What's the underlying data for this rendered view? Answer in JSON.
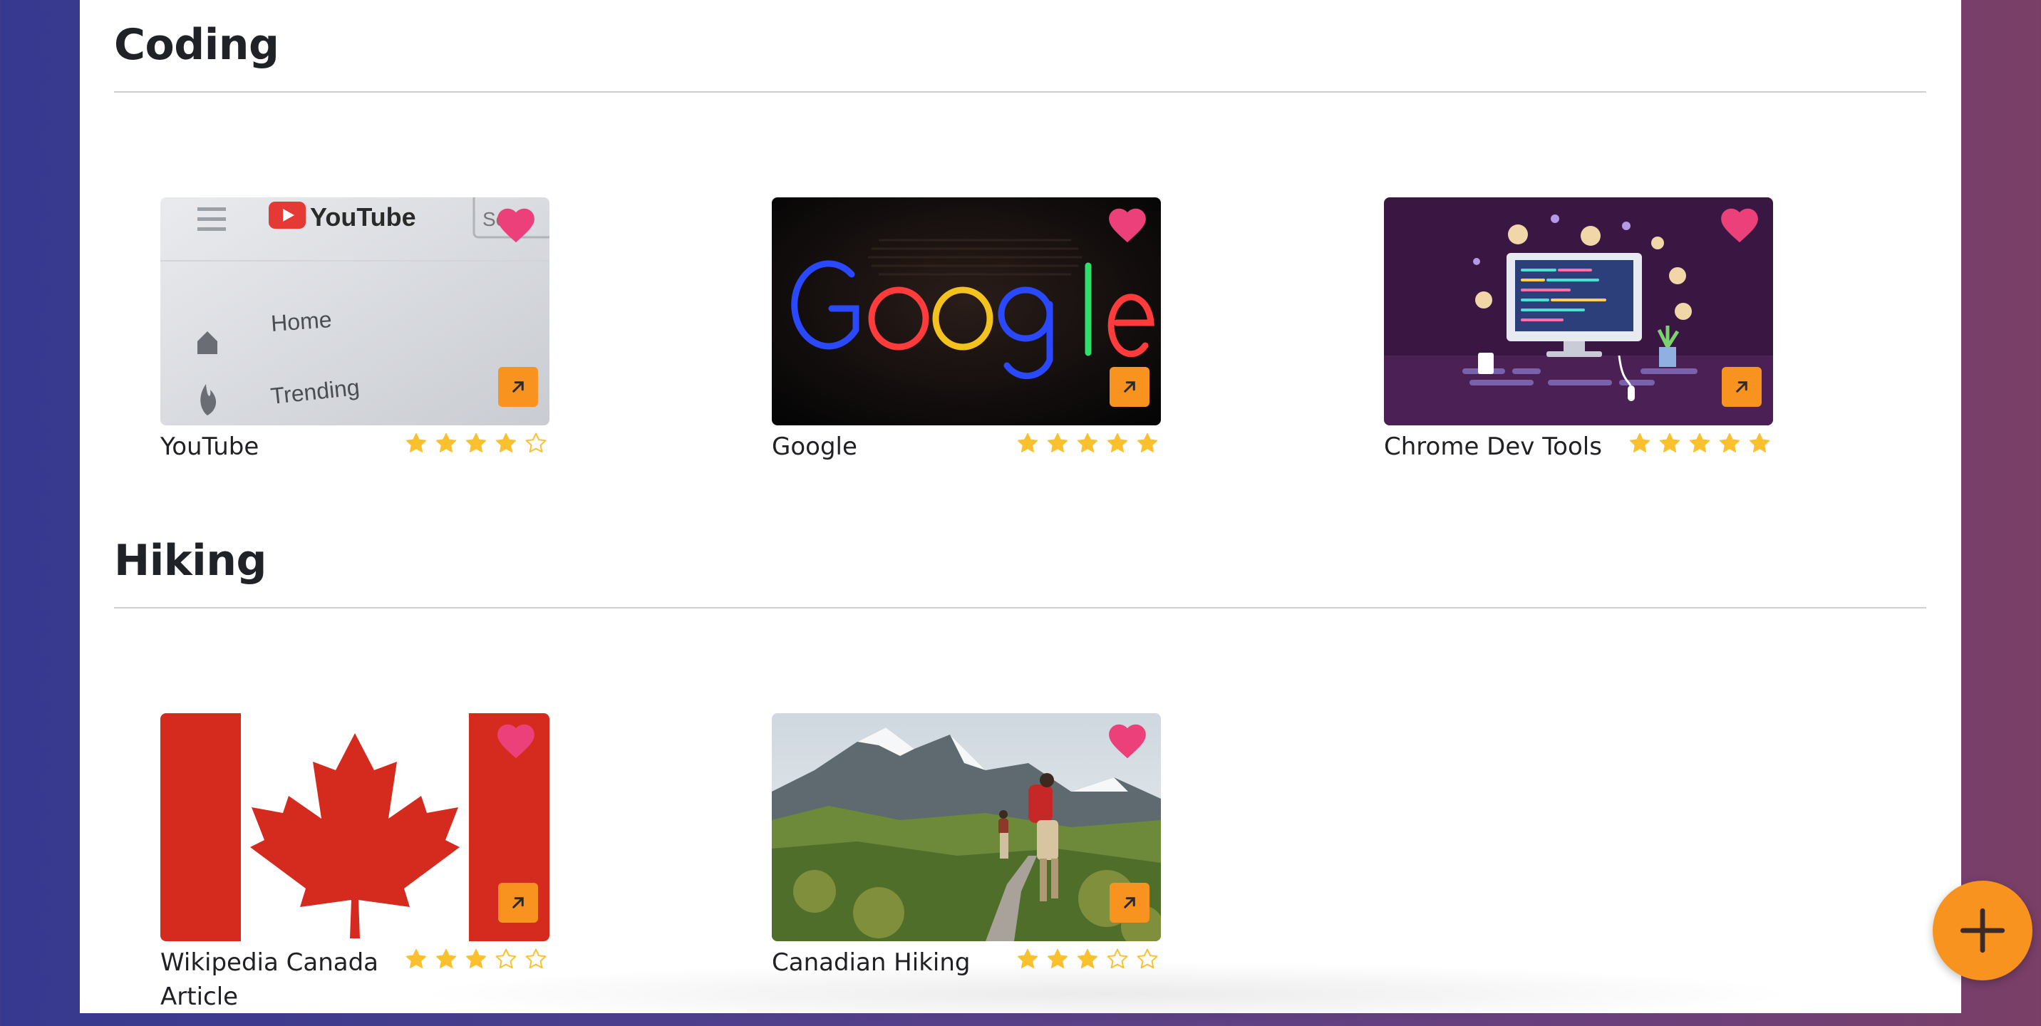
{
  "colors": {
    "accent": "#f7931e",
    "heart": "#ec407a",
    "star": "#fbc02d",
    "text": "#202124"
  },
  "sections": [
    {
      "title": "Coding",
      "cards": [
        {
          "title": "YouTube",
          "rating": 4,
          "image": "youtube-screenshot"
        },
        {
          "title": "Google",
          "rating": 5,
          "image": "google-neon-logo"
        },
        {
          "title": "Chrome Dev Tools",
          "rating": 5,
          "image": "developer-desk-illustration"
        }
      ]
    },
    {
      "title": "Hiking",
      "cards": [
        {
          "title": "Wikipedia Canada Article",
          "rating": 3,
          "image": "canada-flag"
        },
        {
          "title": "Canadian Hiking",
          "rating": 3,
          "image": "mountain-hikers"
        }
      ]
    }
  ],
  "icons": {
    "favorite": "heart-icon",
    "open_link": "arrow-up-right-icon",
    "add": "plus-icon",
    "rating": "star-icon"
  }
}
